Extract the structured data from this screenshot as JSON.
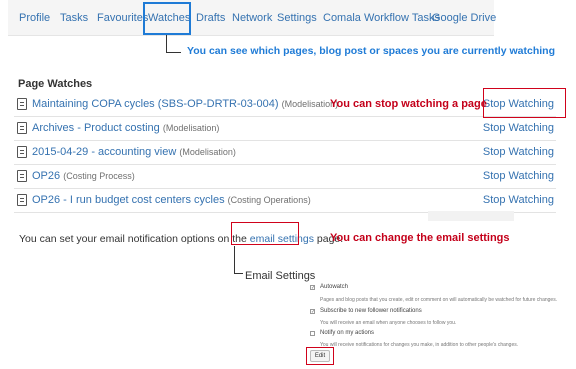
{
  "tabs": [
    {
      "label": "Profile"
    },
    {
      "label": "Tasks"
    },
    {
      "label": "Favourites"
    },
    {
      "label": "Watches"
    },
    {
      "label": "Drafts"
    },
    {
      "label": "Network"
    },
    {
      "label": "Settings"
    },
    {
      "label": "Comala Workflow Tasks"
    },
    {
      "label": "Google Drive"
    }
  ],
  "annotations": {
    "watching_info": "You can see which pages, blog post or spaces you are currently watching",
    "stop_watching": "You can stop watching a page",
    "change_email": "You can change the email settings"
  },
  "page_watches": {
    "title": "Page Watches",
    "rows": [
      {
        "title": "Maintaining COPA cycles (SBS-OP-DRTR-03-004)",
        "space": "(Modelisation)",
        "action": "Stop Watching"
      },
      {
        "title": "Archives - Product costing",
        "space": "(Modelisation)",
        "action": "Stop Watching"
      },
      {
        "title": "2015-04-29 - accounting view",
        "space": "(Modelisation)",
        "action": "Stop Watching"
      },
      {
        "title": "OP26",
        "space": "(Costing Process)",
        "action": "Stop Watching"
      },
      {
        "title": "OP26 - I run budget cost centers cycles",
        "space": "(Costing Operations)",
        "action": "Stop Watching"
      }
    ]
  },
  "note": {
    "prefix": "You can set your email notification options on the ",
    "link": "email settings",
    "suffix": " page."
  },
  "email_settings": {
    "label": "Email Settings",
    "options": [
      {
        "label": "Autowatch",
        "checked": true,
        "description": "Pages and blog posts that you create, edit or comment on will automatically be watched for future changes."
      },
      {
        "label": "Subscribe to new follower notifications",
        "checked": true,
        "description": "You will receive an email when anyone chooses to follow you."
      },
      {
        "label": "Notify on my actions",
        "checked": false,
        "description": "You will receive notifications for changes you make, in addition to other people's changes."
      }
    ],
    "edit_label": "Edit"
  },
  "colors": {
    "link": "#3572b0",
    "annotation_blue": "#1f7bd6",
    "annotation_red": "#c4001a",
    "highlight_red": "#d0021b"
  }
}
